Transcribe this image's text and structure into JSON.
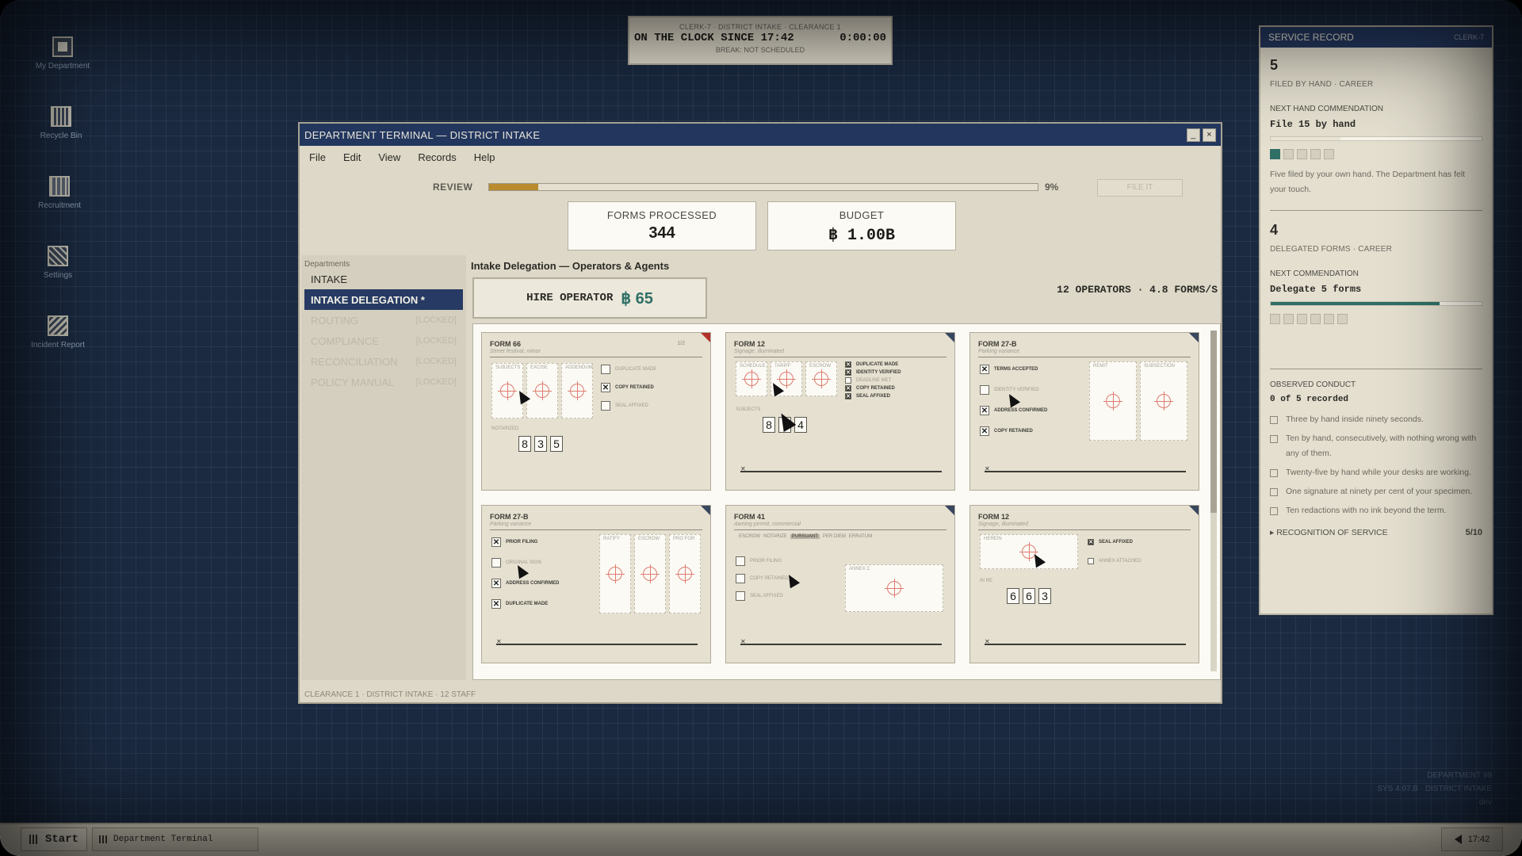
{
  "desktop": {
    "icons": [
      {
        "label": "My Department",
        "icon": "folder-icon"
      },
      {
        "label": "Recycle Bin",
        "icon": "recycle-bin-icon"
      },
      {
        "label": "Recruitment",
        "icon": "recruitment-icon"
      },
      {
        "label": "Settings",
        "icon": "settings-icon"
      },
      {
        "label": "Incident Report",
        "icon": "incident-report-icon"
      }
    ],
    "watermark": [
      "DEPARTMENT 99",
      "SYS 4.07.B · DISTRICT INTAKE",
      "dev"
    ]
  },
  "clock": {
    "line1": "CLERK-7 · DISTRICT INTAKE · CLEARANCE 1",
    "on_clock": "ON THE CLOCK SINCE 17:42",
    "timer": "0:00:00",
    "break": "BREAK: NOT SCHEDULED"
  },
  "record": {
    "title": "SERVICE RECORD",
    "clerk": "CLERK-7",
    "hand_count": "5",
    "hand_label": "FILED BY HAND · CAREER",
    "next_hand_label": "NEXT HAND COMMENDATION",
    "next_hand_goal": "File 15 by hand",
    "hand_progress": 0.33,
    "hand_boxes_on": 1,
    "hand_boxes_total": 5,
    "hand_note": "Five filed by your own hand. The Department has felt your touch.",
    "deleg_count": "4",
    "deleg_label": "DELEGATED FORMS · CAREER",
    "next_deleg_label": "NEXT COMMENDATION",
    "next_deleg_goal": "Delegate 5 forms",
    "deleg_progress": 0.8,
    "deleg_boxes_on": 0,
    "deleg_boxes_total": 6,
    "conduct_label": "OBSERVED CONDUCT",
    "conduct_count": "0 of 5 recorded",
    "conduct": [
      "Three by hand inside ninety seconds.",
      "Ten by hand, consecutively, with nothing wrong with any of them.",
      "Twenty-five by hand while your desks are working.",
      "One signature at ninety per cent of your specimen.",
      "Ten redactions with no ink beyond the term."
    ],
    "recognition_label": "RECOGNITION OF SERVICE",
    "recognition_value": "5/10"
  },
  "window": {
    "title": "DEPARTMENT TERMINAL — DISTRICT INTAKE",
    "minimize": "_",
    "close": "×",
    "menu": [
      "File",
      "Edit",
      "View",
      "Records",
      "Help"
    ],
    "review_label": "REVIEW",
    "review_progress": 0.09,
    "review_pct": "9%",
    "file_it": "FILE IT",
    "forms_processed_label": "FORMS PROCESSED",
    "forms_processed": "344",
    "budget_label": "BUDGET",
    "budget": "฿ 1.00B",
    "departments_label": "Departments",
    "departments": [
      {
        "name": "INTAKE",
        "state": "normal",
        "lock": ""
      },
      {
        "name": "INTAKE DELEGATION *",
        "state": "active",
        "lock": ""
      },
      {
        "name": "ROUTING",
        "state": "locked",
        "lock": "[LOCKED]"
      },
      {
        "name": "COMPLIANCE",
        "state": "locked",
        "lock": "[LOCKED]"
      },
      {
        "name": "RECONCILIATION",
        "state": "locked",
        "lock": "[LOCKED]"
      },
      {
        "name": "POLICY MANUAL",
        "state": "locked",
        "lock": "[LOCKED]"
      }
    ],
    "panel_title": "Intake Delegation — Operators & Agents",
    "hire_label": "HIRE OPERATOR",
    "hire_price": "฿ 65",
    "operators_summary": "12 OPERATORS · 4.8 FORMS/S",
    "status_bar": "CLEARANCE 1 · DISTRICT INTAKE · 12 STAFF"
  },
  "forms": [
    {
      "name": "FORM 66",
      "sub": "Street festival, minor",
      "page": "1/2",
      "corner": "red",
      "fields": [
        "SUBJECTS",
        "EXCISE",
        "ADDENDUM"
      ],
      "checks": [
        {
          "label": "DUPLICATE MADE",
          "on": false
        },
        {
          "label": "COPY RETAINED",
          "on": true
        },
        {
          "label": "SEAL AFFIXED",
          "on": false
        }
      ],
      "digits_label": "NOTARIZED",
      "digits": [
        "8",
        "3",
        "5"
      ]
    },
    {
      "name": "FORM 12",
      "sub": "Signage, illuminated",
      "page": "",
      "corner": "dark",
      "fields": [
        "SCHEDULE",
        "TARIFF",
        "ESCROW"
      ],
      "checks": [
        {
          "label": "DUPLICATE MADE",
          "on": true
        },
        {
          "label": "IDENTITY VERIFIED",
          "on": true
        },
        {
          "label": "DEADLINE MET",
          "on": false
        },
        {
          "label": "COPY RETAINED",
          "on": true
        },
        {
          "label": "SEAL AFFIXED",
          "on": true
        }
      ],
      "digits_label": "SUBJECTS",
      "digits": [
        "8",
        "",
        "4"
      ]
    },
    {
      "name": "FORM 27-B",
      "sub": "Parking variance",
      "page": "",
      "corner": "dark",
      "fields": [
        "REMIT",
        "SUBSECTION"
      ],
      "checks": [
        {
          "label": "TERMS ACCEPTED",
          "on": true
        },
        {
          "label": "IDENTITY VERIFIED",
          "on": false
        },
        {
          "label": "ADDRESS CONFIRMED",
          "on": true
        },
        {
          "label": "COPY RETAINED",
          "on": true
        }
      ],
      "digits_label": "",
      "digits": []
    },
    {
      "name": "FORM 27-B",
      "sub": "Parking variance",
      "page": "",
      "corner": "dark",
      "fields": [
        "RATIFY",
        "ESCROW",
        "PRO FOR"
      ],
      "checks": [
        {
          "label": "PRIOR FILING",
          "on": true
        },
        {
          "label": "ORIGINAL SIGN",
          "on": false
        },
        {
          "label": "ADDRESS CONFIRMED",
          "on": true
        },
        {
          "label": "DUPLICATE MADE",
          "on": true
        }
      ],
      "digits_label": "",
      "digits": []
    },
    {
      "name": "FORM 41",
      "sub": "Awning permit, commercial",
      "page": "",
      "corner": "dark",
      "tabs": [
        "ESCROW",
        "NOTARIZE",
        "PURSUANT",
        "PER DIEM",
        "ERRATUM"
      ],
      "selected_tab": "PURSUANT",
      "fields": [
        "ANNEX C"
      ],
      "checks": [
        {
          "label": "PRIOR FILING",
          "on": false
        },
        {
          "label": "COPY RETAINED",
          "on": false
        },
        {
          "label": "SEAL AFFIXED",
          "on": false
        }
      ],
      "digits_label": "",
      "digits": []
    },
    {
      "name": "FORM 12",
      "sub": "Signage, illuminated",
      "page": "",
      "corner": "dark",
      "fields": [
        "HEREIN"
      ],
      "checks": [
        {
          "label": "SEAL AFFIXED",
          "on": true
        },
        {
          "label": "ANNEX ATTACHED",
          "on": false
        }
      ],
      "digits_label": "IN RE",
      "digits": [
        "6",
        "6",
        "3"
      ]
    }
  ],
  "taskbar": {
    "start": "Start",
    "task": "Department Terminal",
    "time": "17:42"
  }
}
